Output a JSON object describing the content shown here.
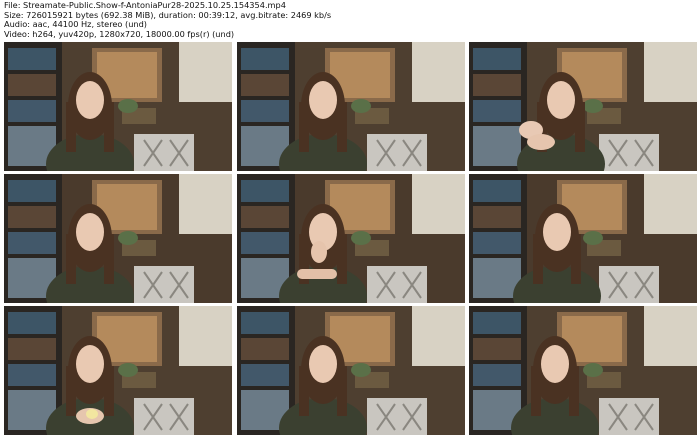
{
  "header": {
    "file_line": "File: Streamate-Public.Show-f-AntoniaPur28-2025.10.25.154354.mp4",
    "size_line": "Size: 726015921 bytes (692.38 MiB), duration: 00:39:12, avg.bitrate: 2469 kb/s",
    "audio_line": "Audio: aac, 44100 Hz, stereo (und)",
    "video_line": "Video: h264, yuv420p, 1280x720, 18000.00 fps(r) (und)"
  },
  "thumbnails": [
    {
      "pose": "neutral"
    },
    {
      "pose": "neutral"
    },
    {
      "pose": "hands-up"
    },
    {
      "pose": "neutral"
    },
    {
      "pose": "hand-chin"
    },
    {
      "pose": "lean"
    },
    {
      "pose": "holding-object"
    },
    {
      "pose": "neutral"
    },
    {
      "pose": "neutral"
    }
  ]
}
